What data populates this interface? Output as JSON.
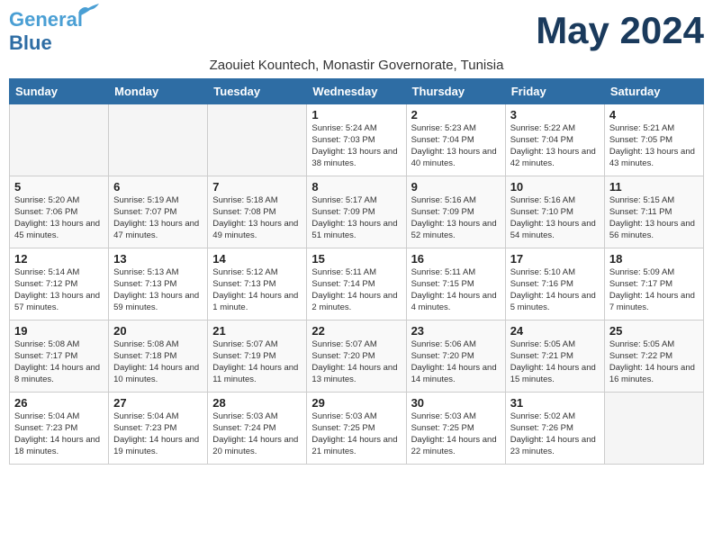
{
  "header": {
    "logo_line1": "General",
    "logo_line2": "Blue",
    "month_title": "May 2024",
    "subtitle": "Zaouiet Kountech, Monastir Governorate, Tunisia"
  },
  "weekdays": [
    "Sunday",
    "Monday",
    "Tuesday",
    "Wednesday",
    "Thursday",
    "Friday",
    "Saturday"
  ],
  "weeks": [
    [
      {
        "day": "",
        "empty": true
      },
      {
        "day": "",
        "empty": true
      },
      {
        "day": "",
        "empty": true
      },
      {
        "day": "1",
        "sunrise": "5:24 AM",
        "sunset": "7:03 PM",
        "daylight": "13 hours and 38 minutes."
      },
      {
        "day": "2",
        "sunrise": "5:23 AM",
        "sunset": "7:04 PM",
        "daylight": "13 hours and 40 minutes."
      },
      {
        "day": "3",
        "sunrise": "5:22 AM",
        "sunset": "7:04 PM",
        "daylight": "13 hours and 42 minutes."
      },
      {
        "day": "4",
        "sunrise": "5:21 AM",
        "sunset": "7:05 PM",
        "daylight": "13 hours and 43 minutes."
      }
    ],
    [
      {
        "day": "5",
        "sunrise": "5:20 AM",
        "sunset": "7:06 PM",
        "daylight": "13 hours and 45 minutes."
      },
      {
        "day": "6",
        "sunrise": "5:19 AM",
        "sunset": "7:07 PM",
        "daylight": "13 hours and 47 minutes."
      },
      {
        "day": "7",
        "sunrise": "5:18 AM",
        "sunset": "7:08 PM",
        "daylight": "13 hours and 49 minutes."
      },
      {
        "day": "8",
        "sunrise": "5:17 AM",
        "sunset": "7:09 PM",
        "daylight": "13 hours and 51 minutes."
      },
      {
        "day": "9",
        "sunrise": "5:16 AM",
        "sunset": "7:09 PM",
        "daylight": "13 hours and 52 minutes."
      },
      {
        "day": "10",
        "sunrise": "5:16 AM",
        "sunset": "7:10 PM",
        "daylight": "13 hours and 54 minutes."
      },
      {
        "day": "11",
        "sunrise": "5:15 AM",
        "sunset": "7:11 PM",
        "daylight": "13 hours and 56 minutes."
      }
    ],
    [
      {
        "day": "12",
        "sunrise": "5:14 AM",
        "sunset": "7:12 PM",
        "daylight": "13 hours and 57 minutes."
      },
      {
        "day": "13",
        "sunrise": "5:13 AM",
        "sunset": "7:13 PM",
        "daylight": "13 hours and 59 minutes."
      },
      {
        "day": "14",
        "sunrise": "5:12 AM",
        "sunset": "7:13 PM",
        "daylight": "14 hours and 1 minute."
      },
      {
        "day": "15",
        "sunrise": "5:11 AM",
        "sunset": "7:14 PM",
        "daylight": "14 hours and 2 minutes."
      },
      {
        "day": "16",
        "sunrise": "5:11 AM",
        "sunset": "7:15 PM",
        "daylight": "14 hours and 4 minutes."
      },
      {
        "day": "17",
        "sunrise": "5:10 AM",
        "sunset": "7:16 PM",
        "daylight": "14 hours and 5 minutes."
      },
      {
        "day": "18",
        "sunrise": "5:09 AM",
        "sunset": "7:17 PM",
        "daylight": "14 hours and 7 minutes."
      }
    ],
    [
      {
        "day": "19",
        "sunrise": "5:08 AM",
        "sunset": "7:17 PM",
        "daylight": "14 hours and 8 minutes."
      },
      {
        "day": "20",
        "sunrise": "5:08 AM",
        "sunset": "7:18 PM",
        "daylight": "14 hours and 10 minutes."
      },
      {
        "day": "21",
        "sunrise": "5:07 AM",
        "sunset": "7:19 PM",
        "daylight": "14 hours and 11 minutes."
      },
      {
        "day": "22",
        "sunrise": "5:07 AM",
        "sunset": "7:20 PM",
        "daylight": "14 hours and 13 minutes."
      },
      {
        "day": "23",
        "sunrise": "5:06 AM",
        "sunset": "7:20 PM",
        "daylight": "14 hours and 14 minutes."
      },
      {
        "day": "24",
        "sunrise": "5:05 AM",
        "sunset": "7:21 PM",
        "daylight": "14 hours and 15 minutes."
      },
      {
        "day": "25",
        "sunrise": "5:05 AM",
        "sunset": "7:22 PM",
        "daylight": "14 hours and 16 minutes."
      }
    ],
    [
      {
        "day": "26",
        "sunrise": "5:04 AM",
        "sunset": "7:23 PM",
        "daylight": "14 hours and 18 minutes."
      },
      {
        "day": "27",
        "sunrise": "5:04 AM",
        "sunset": "7:23 PM",
        "daylight": "14 hours and 19 minutes."
      },
      {
        "day": "28",
        "sunrise": "5:03 AM",
        "sunset": "7:24 PM",
        "daylight": "14 hours and 20 minutes."
      },
      {
        "day": "29",
        "sunrise": "5:03 AM",
        "sunset": "7:25 PM",
        "daylight": "14 hours and 21 minutes."
      },
      {
        "day": "30",
        "sunrise": "5:03 AM",
        "sunset": "7:25 PM",
        "daylight": "14 hours and 22 minutes."
      },
      {
        "day": "31",
        "sunrise": "5:02 AM",
        "sunset": "7:26 PM",
        "daylight": "14 hours and 23 minutes."
      },
      {
        "day": "",
        "empty": true
      }
    ]
  ]
}
